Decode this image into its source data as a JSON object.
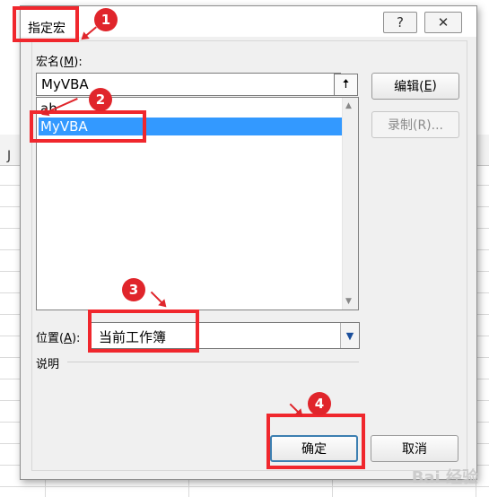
{
  "background": {
    "column_header": "J"
  },
  "dialog": {
    "title": "指定宏",
    "help_symbol": "?",
    "close_symbol": "✕",
    "macro_name_label": "宏名(",
    "macro_name_key": "M",
    "macro_name_suffix": "):",
    "macro_name_value": "MyVBA",
    "macro_list": [
      "ab",
      "MyVBA"
    ],
    "selected_index": 1,
    "edit_label": "编辑(",
    "edit_key": "E",
    "edit_suffix": ")",
    "record_label": "录制(R)...",
    "location_label": "位置(",
    "location_key": "A",
    "location_suffix": "):",
    "location_value": "当前工作簿",
    "description_label": "说明",
    "ok_label": "确定",
    "cancel_label": "取消"
  },
  "annotations": {
    "steps": [
      "1",
      "2",
      "3",
      "4"
    ],
    "color": "#e0252b"
  },
  "watermark": "Bai 经验"
}
